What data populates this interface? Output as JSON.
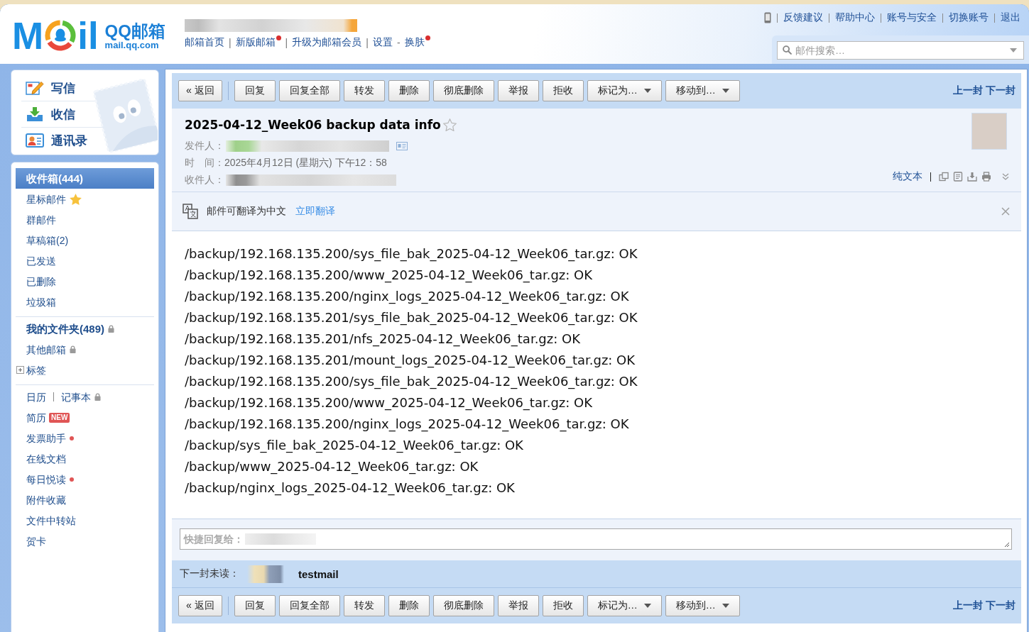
{
  "header": {
    "logo": {
      "mark_left": "M",
      "mark_right": "il",
      "name": "QQ邮箱",
      "domain": "mail.qq.com"
    },
    "nav_links": [
      {
        "label": "邮箱首页",
        "new_dot": false
      },
      {
        "separator": "|",
        "label": "新版邮箱",
        "new_dot": true
      },
      {
        "separator": "|",
        "label": "升级为邮箱会员",
        "new_dot": false
      },
      {
        "separator": "|",
        "label": "设置",
        "new_dot": false
      },
      {
        "separator": "-",
        "label": "换肤",
        "new_dot": true
      }
    ],
    "top_links": [
      "反馈建议",
      "帮助中心",
      "账号与安全",
      "切换账号",
      "退出"
    ],
    "search": {
      "placeholder": "邮件搜索…"
    }
  },
  "sidebar": {
    "actions": [
      {
        "kind": "compose",
        "label": "写信"
      },
      {
        "kind": "receive",
        "label": "收信"
      },
      {
        "kind": "contacts",
        "label": "通讯录"
      }
    ],
    "folder_groups": [
      {
        "items": [
          {
            "kind": "plain",
            "label": "收件箱(444)",
            "selected": true,
            "bold": true
          },
          {
            "kind": "starred",
            "label": "星标邮件",
            "selected": false,
            "bold": false
          },
          {
            "kind": "plain",
            "label": "群邮件",
            "selected": false,
            "bold": false
          },
          {
            "kind": "plain",
            "label": "草稿箱(2)",
            "selected": false,
            "bold": false
          },
          {
            "kind": "plain",
            "label": "已发送",
            "selected": false,
            "bold": false
          },
          {
            "kind": "plain",
            "label": "已删除",
            "selected": false,
            "bold": false
          },
          {
            "kind": "plain",
            "label": "垃圾箱",
            "selected": false,
            "bold": false
          }
        ]
      },
      {
        "items": [
          {
            "kind": "locked",
            "label": "我的文件夹(489)",
            "selected": false,
            "bold": true
          },
          {
            "kind": "locked",
            "label": "其他邮箱",
            "selected": false,
            "bold": false
          },
          {
            "kind": "expandable",
            "label": "标签",
            "selected": false,
            "bold": false,
            "expanded": false
          }
        ]
      },
      {
        "items": [
          {
            "kind": "locked",
            "label": "日历",
            "second_label": "记事本",
            "selected": false,
            "bold": false
          },
          {
            "kind": "plain",
            "label": "简历",
            "selected": false,
            "bold": false,
            "badge": "NEW"
          },
          {
            "kind": "alert",
            "label": "发票助手",
            "selected": false,
            "bold": false
          },
          {
            "kind": "plain",
            "label": "在线文档",
            "selected": false,
            "bold": false
          },
          {
            "kind": "alert",
            "label": "每日悦读",
            "selected": false,
            "bold": false
          },
          {
            "kind": "plain",
            "label": "附件收藏",
            "selected": false,
            "bold": false
          },
          {
            "kind": "plain",
            "label": "文件中转站",
            "selected": false,
            "bold": false
          },
          {
            "kind": "plain",
            "label": "贺卡",
            "selected": false,
            "bold": false
          }
        ]
      }
    ]
  },
  "mail": {
    "toolbar_top": {
      "back": "« 返回",
      "actions": [
        {
          "label": "回复",
          "dropdown": false
        },
        {
          "label": "回复全部",
          "dropdown": false
        },
        {
          "label": "转发",
          "dropdown": false
        },
        {
          "label": "删除",
          "dropdown": false
        },
        {
          "label": "彻底删除",
          "dropdown": false
        },
        {
          "label": "举报",
          "dropdown": false
        },
        {
          "label": "拒收",
          "dropdown": false
        },
        {
          "label": "标记为…",
          "dropdown": true
        },
        {
          "label": "移动到…",
          "dropdown": true
        }
      ],
      "prev": "上一封",
      "next": "下一封"
    },
    "subject": "2025-04-12_Week06 backup data info",
    "starred": false,
    "sender": {
      "label": "发件人："
    },
    "time": {
      "label": "时　间：",
      "value": "2025年4月12日 (星期六) 下午12：58"
    },
    "recipient": {
      "label": "收件人："
    },
    "plain_text": "纯文本",
    "translate": {
      "message": "邮件可翻译为中文",
      "action": "立即翻译"
    },
    "body_lines": [
      "/backup/192.168.135.200/sys_file_bak_2025-04-12_Week06_tar.gz: OK",
      "/backup/192.168.135.200/www_2025-04-12_Week06_tar.gz: OK",
      "/backup/192.168.135.200/nginx_logs_2025-04-12_Week06_tar.gz: OK",
      "/backup/192.168.135.201/sys_file_bak_2025-04-12_Week06_tar.gz: OK",
      "/backup/192.168.135.201/nfs_2025-04-12_Week06_tar.gz: OK",
      "/backup/192.168.135.201/mount_logs_2025-04-12_Week06_tar.gz: OK",
      "/backup/192.168.135.200/sys_file_bak_2025-04-12_Week06_tar.gz: OK",
      "/backup/192.168.135.200/www_2025-04-12_Week06_tar.gz: OK",
      "/backup/192.168.135.200/nginx_logs_2025-04-12_Week06_tar.gz: OK",
      "/backup/sys_file_bak_2025-04-12_Week06_tar.gz: OK",
      "/backup/www_2025-04-12_Week06_tar.gz: OK",
      "/backup/nginx_logs_2025-04-12_Week06_tar.gz: OK"
    ],
    "quick_reply": {
      "placeholder": "快捷回复给："
    },
    "next_unread": {
      "label": "下一封未读：",
      "subject": "testmail"
    },
    "toolbar_bottom": {
      "back": "« 返回",
      "actions": [
        {
          "label": "回复",
          "dropdown": false
        },
        {
          "label": "回复全部",
          "dropdown": false
        },
        {
          "label": "转发",
          "dropdown": false
        },
        {
          "label": "删除",
          "dropdown": false
        },
        {
          "label": "彻底删除",
          "dropdown": false
        },
        {
          "label": "举报",
          "dropdown": false
        },
        {
          "label": "拒收",
          "dropdown": false
        },
        {
          "label": "标记为…",
          "dropdown": true
        },
        {
          "label": "移动到…",
          "dropdown": true
        }
      ],
      "prev": "上一封",
      "next": "下一封"
    }
  }
}
